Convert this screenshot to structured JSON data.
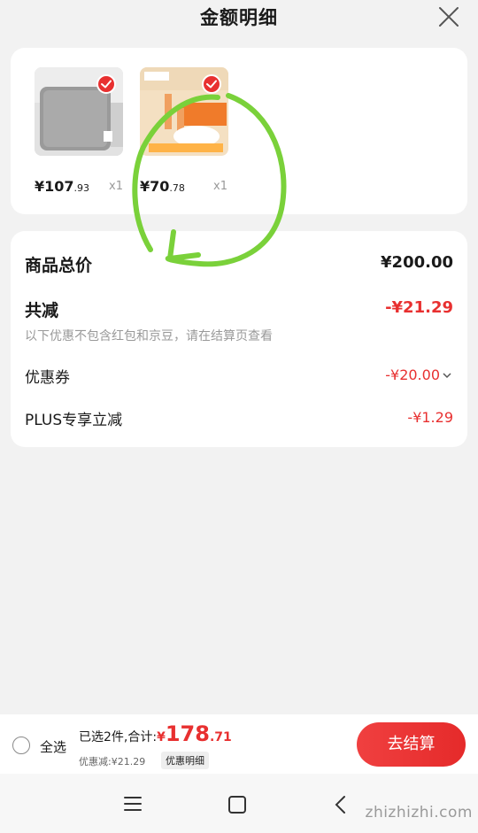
{
  "header": {
    "title": "金额明细"
  },
  "goods": [
    {
      "price_int": "¥107",
      "price_dec": ".93",
      "qty": "x1"
    },
    {
      "price_int": "¥70",
      "price_dec": ".78",
      "qty": "x1"
    }
  ],
  "summary": {
    "total_label": "商品总价",
    "total_value": "¥200.00",
    "reduce_label": "共减",
    "reduce_value": "-¥21.29",
    "reduce_note": "以下优惠不包含红包和京豆，请在结算页查看",
    "coupon_label": "优惠券",
    "coupon_value": "-¥20.00",
    "plus_label": "PLUS专享立减",
    "plus_value": "-¥1.29"
  },
  "bottom": {
    "select_all": "全选",
    "selected_summary": "已选2件,合计:",
    "total_currency": "¥",
    "total_int": "178",
    "total_dec": ".71",
    "discount_text": "优惠减:¥21.29",
    "detail_tag": "优惠明细",
    "checkout": "去结算"
  },
  "watermark": {
    "text": "zhizhizhi.com"
  },
  "colors": {
    "accent": "#e83030",
    "annotation": "#7ad13a",
    "background": "#f2f2f2"
  },
  "icons": [
    "close-icon",
    "check-icon",
    "chevron-down-icon",
    "menu-icon",
    "home-square-icon",
    "back-chevron-icon"
  ]
}
